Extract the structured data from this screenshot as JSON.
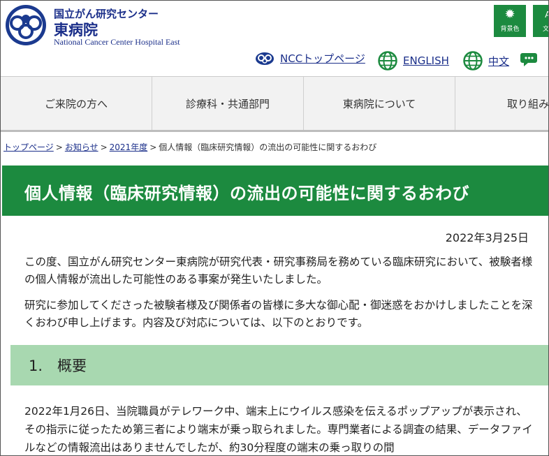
{
  "header": {
    "org_line1": "国立がん研究センター",
    "org_line2": "東病院",
    "org_line3": "National Cancer Center Hospital East",
    "logo_icon": "ncc-logo-icon",
    "tools": [
      {
        "label": "背景色",
        "icon": "brightness-icon"
      },
      {
        "label": "文字",
        "icon": "text-size-icon"
      }
    ],
    "links": [
      {
        "label": "NCCトップページ",
        "icon": "ncc-logo-small-icon"
      },
      {
        "label": "ENGLISH",
        "icon": "globe-icon"
      },
      {
        "label": "中文",
        "icon": "globe-icon"
      },
      {
        "label": "",
        "icon": "chat-icon"
      }
    ],
    "accent_color": "#1c8a3f",
    "brand_color": "#1b2f8a"
  },
  "nav": {
    "items": [
      "ご来院の方へ",
      "診療科・共通部門",
      "東病院について",
      "取り組み"
    ]
  },
  "breadcrumb": {
    "items": [
      "トップページ",
      "お知らせ",
      "2021年度"
    ],
    "current": "個人情報（臨床研究情報）の流出の可能性に関するおわび",
    "separator": ">"
  },
  "article": {
    "title": "個人情報（臨床研究情報）の流出の可能性に関するおわび",
    "date": "2022年3月25日",
    "paragraphs": [
      "この度、国立がん研究センター東病院が研究代表・研究事務局を務めている臨床研究において、被験者様の個人情報が流出した可能性のある事案が発生いたしました。",
      "研究に参加してくださった被験者様及び関係者の皆様に多大な御心配・御迷惑をおかけしましたことを深くおわび申し上げます。内容及び対応については、以下のとおりです。"
    ],
    "section_heading": "1.　概要",
    "section_text": "2022年1月26日、当院職員がテレワーク中、端末上にウイルス感染を伝えるポップアップが表示され、その指示に従ったため第三者により端末が乗っ取られました。専門業者による調査の結果、データファイルなどの情報流出はありませんでしたが、約30分程度の端末の乗っ取りの間"
  }
}
